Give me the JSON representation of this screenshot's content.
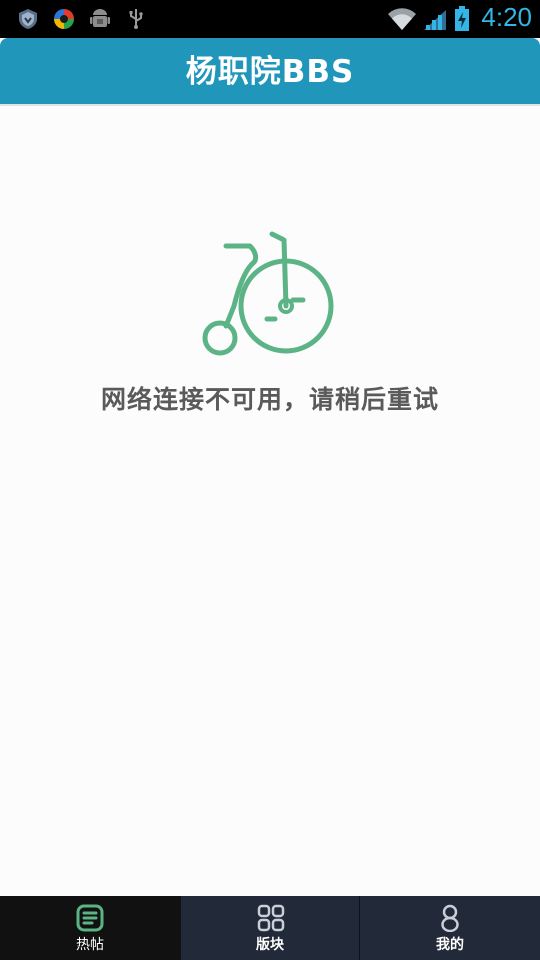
{
  "status_bar": {
    "time": "4:20",
    "left_icons": [
      "shield-icon",
      "app-ring-icon",
      "android-debug-icon",
      "usb-icon"
    ],
    "right_icons": [
      "wifi-icon",
      "signal-icon",
      "battery-charging-icon"
    ],
    "accent_color": "#33b5e5"
  },
  "header": {
    "title": "杨职院BBS",
    "background_color": "#1f96ba"
  },
  "main": {
    "illustration": "penny-farthing-bicycle-icon",
    "illustration_color": "#5bb386",
    "message": "网络连接不可用，请稍后重试"
  },
  "bottom_nav": {
    "tabs": [
      {
        "label": "热帖",
        "icon": "document-icon",
        "active": true
      },
      {
        "label": "版块",
        "icon": "grid-icon",
        "active": false
      },
      {
        "label": "我的",
        "icon": "person-icon",
        "active": false
      }
    ],
    "active_icon_color": "#5bb386"
  }
}
